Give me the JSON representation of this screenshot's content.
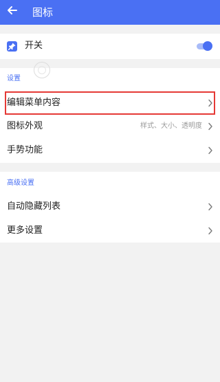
{
  "header": {
    "title": "图标",
    "back_icon": "back-arrow-icon",
    "background": "#4a70f3"
  },
  "switch_row": {
    "label": "开关",
    "icon": "pin-icon",
    "enabled": true
  },
  "settings_section": {
    "title": "设置",
    "items": [
      {
        "label": "编辑菜单内容",
        "hint": ""
      },
      {
        "label": "图标外观",
        "hint": "样式、大小、透明度"
      },
      {
        "label": "手势功能",
        "hint": ""
      }
    ]
  },
  "advanced_section": {
    "title": "高级设置",
    "items": [
      {
        "label": "自动隐藏列表"
      },
      {
        "label": "更多设置"
      }
    ]
  },
  "colors": {
    "accent": "#4a70f3",
    "highlight_border": "#e53935"
  }
}
